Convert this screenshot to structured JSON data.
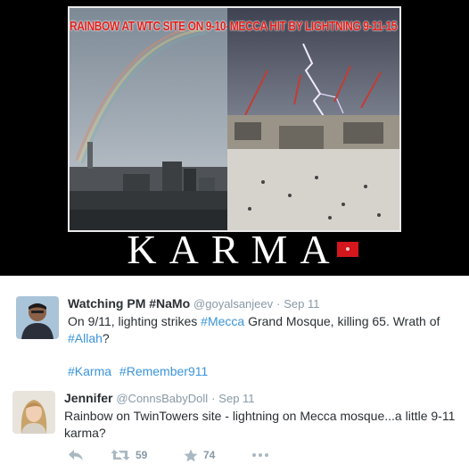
{
  "poster": {
    "left_caption": "RAINBOW AT WTC SITE ON 9-10-15",
    "right_caption": "MECCA HIT BY LIGHTNING 9-11-15",
    "headline": "KARMA",
    "colors": {
      "caption": "#e0201b",
      "background": "#000000"
    }
  },
  "tweets": [
    {
      "fullname": "Watching PM #NaMo",
      "username": "@goyalsanjeev",
      "separator": "·",
      "time": "Sep 11",
      "text_parts": [
        "On 9/11, lighting strikes ",
        "#Mecca",
        " Grand Mosque, killing 65. Wrath of ",
        "#Allah",
        "?"
      ],
      "hashtags": [
        "#Karma",
        "#Remember911"
      ]
    },
    {
      "fullname": "Jennifer",
      "username": "@ConnsBabyDoll",
      "separator": "·",
      "time": "Sep 11",
      "text": "Rainbow on TwinTowers site - lightning on Mecca mosque...a little 9-11 karma?",
      "actions": {
        "reply_icon": "reply-icon",
        "retweet_icon": "retweet-icon",
        "retweet_count": "59",
        "like_icon": "star-icon",
        "like_count": "74",
        "more_icon": "more-dots-icon"
      }
    }
  ],
  "colors": {
    "link": "#3b94d9",
    "meta": "#8899a6",
    "action": "#aab8c2"
  }
}
